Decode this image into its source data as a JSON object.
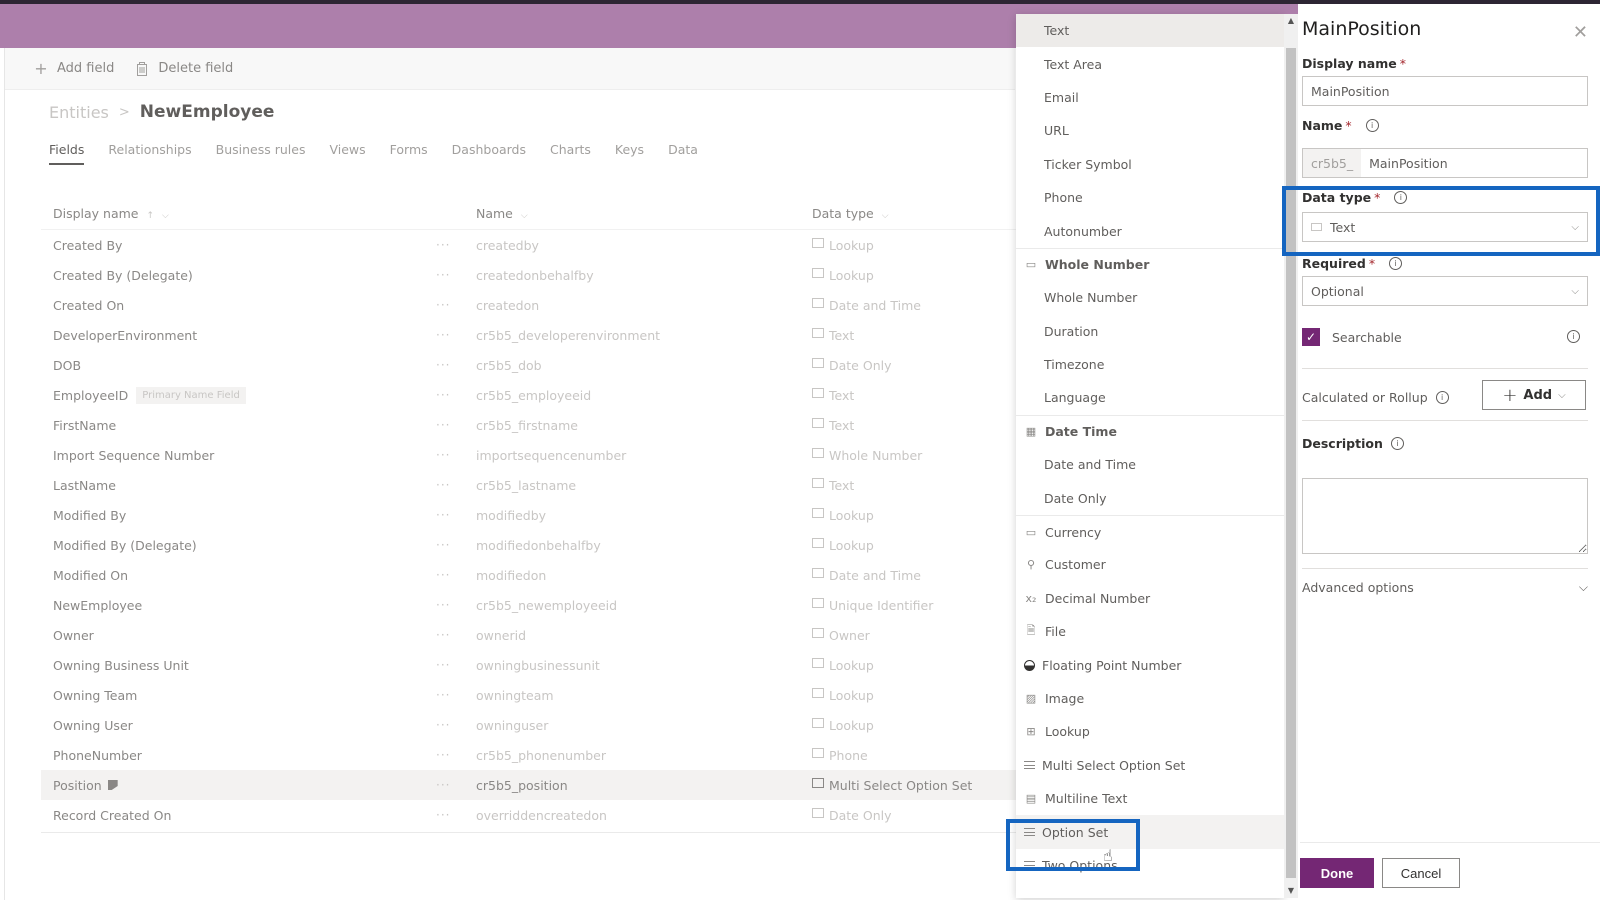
{
  "command_bar": {
    "add_field": "Add field",
    "delete_field": "Delete field"
  },
  "breadcrumb": {
    "root": "Entities",
    "separator": ">",
    "current": "NewEmployee"
  },
  "tabs": [
    {
      "label": "Fields",
      "active": true
    },
    {
      "label": "Relationships"
    },
    {
      "label": "Business rules"
    },
    {
      "label": "Views"
    },
    {
      "label": "Forms"
    },
    {
      "label": "Dashboards"
    },
    {
      "label": "Charts"
    },
    {
      "label": "Keys"
    },
    {
      "label": "Data"
    }
  ],
  "grid": {
    "columns": {
      "display_name": "Display name",
      "display_name_sort": "↑",
      "name": "Name",
      "data_type": "Data type"
    },
    "more": "···",
    "rows": [
      {
        "display": "Created By",
        "name": "createdby",
        "type": "Lookup"
      },
      {
        "display": "Created By (Delegate)",
        "name": "createdonbehalfby",
        "type": "Lookup"
      },
      {
        "display": "Created On",
        "name": "createdon",
        "type": "Date and Time"
      },
      {
        "display": "DeveloperEnvironment",
        "name": "cr5b5_developerenvironment",
        "type": "Text"
      },
      {
        "display": "DOB",
        "name": "cr5b5_dob",
        "type": "Date Only"
      },
      {
        "display": "EmployeeID",
        "name": "cr5b5_employeeid",
        "type": "Text",
        "tag": "Primary Name Field"
      },
      {
        "display": "FirstName",
        "name": "cr5b5_firstname",
        "type": "Text"
      },
      {
        "display": "Import Sequence Number",
        "name": "importsequencenumber",
        "type": "Whole Number"
      },
      {
        "display": "LastName",
        "name": "cr5b5_lastname",
        "type": "Text"
      },
      {
        "display": "Modified By",
        "name": "modifiedby",
        "type": "Lookup"
      },
      {
        "display": "Modified By (Delegate)",
        "name": "modifiedonbehalfby",
        "type": "Lookup"
      },
      {
        "display": "Modified On",
        "name": "modifiedon",
        "type": "Date and Time"
      },
      {
        "display": "NewEmployee",
        "name": "cr5b5_newemployeeid",
        "type": "Unique Identifier"
      },
      {
        "display": "Owner",
        "name": "ownerid",
        "type": "Owner"
      },
      {
        "display": "Owning Business Unit",
        "name": "owningbusinessunit",
        "type": "Lookup"
      },
      {
        "display": "Owning Team",
        "name": "owningteam",
        "type": "Lookup"
      },
      {
        "display": "Owning User",
        "name": "owninguser",
        "type": "Lookup"
      },
      {
        "display": "PhoneNumber",
        "name": "cr5b5_phonenumber",
        "type": "Phone"
      },
      {
        "display": "Position",
        "name": "cr5b5_position",
        "type": "Multi Select Option Set",
        "selected": true
      },
      {
        "display": "Record Created On",
        "name": "overriddencreatedon",
        "type": "Date Only"
      }
    ]
  },
  "dropdown": {
    "options": [
      {
        "label": "Text",
        "kind": "item",
        "highlighted": true
      },
      {
        "label": "Text Area",
        "kind": "item"
      },
      {
        "label": "Email",
        "kind": "item"
      },
      {
        "label": "URL",
        "kind": "item"
      },
      {
        "label": "Ticker Symbol",
        "kind": "item"
      },
      {
        "label": "Phone",
        "kind": "item"
      },
      {
        "label": "Autonumber",
        "kind": "item"
      },
      {
        "label": "Whole Number",
        "kind": "group",
        "icon": "whole-number-icon"
      },
      {
        "label": "Whole Number",
        "kind": "item"
      },
      {
        "label": "Duration",
        "kind": "item"
      },
      {
        "label": "Timezone",
        "kind": "item"
      },
      {
        "label": "Language",
        "kind": "item"
      },
      {
        "label": "Date Time",
        "kind": "group",
        "icon": "date-time-icon"
      },
      {
        "label": "Date and Time",
        "kind": "item"
      },
      {
        "label": "Date Only",
        "kind": "item"
      },
      {
        "label": "Currency",
        "kind": "group-item",
        "icon": "currency-icon"
      },
      {
        "label": "Customer",
        "kind": "icon-item",
        "icon": "customer-icon"
      },
      {
        "label": "Decimal Number",
        "kind": "icon-item",
        "icon": "decimal-icon"
      },
      {
        "label": "File",
        "kind": "icon-item",
        "icon": "file-icon"
      },
      {
        "label": "Floating Point Number",
        "kind": "icon-item",
        "icon": "floating-point-icon"
      },
      {
        "label": "Image",
        "kind": "icon-item",
        "icon": "image-icon"
      },
      {
        "label": "Lookup",
        "kind": "icon-item",
        "icon": "lookup-icon"
      },
      {
        "label": "Multi Select Option Set",
        "kind": "icon-item",
        "icon": "option-set-icon"
      },
      {
        "label": "Multiline Text",
        "kind": "icon-item",
        "icon": "multiline-text-icon"
      },
      {
        "label": "Option Set",
        "kind": "icon-item",
        "icon": "option-set-icon",
        "hovered": true
      },
      {
        "label": "Two Options",
        "kind": "icon-item",
        "icon": "option-set-icon"
      }
    ]
  },
  "panel": {
    "title": "MainPosition",
    "display_name_label": "Display name",
    "display_name_value": "MainPosition",
    "name_label": "Name",
    "name_prefix": "cr5b5_",
    "name_value": "MainPosition",
    "data_type_label": "Data type",
    "data_type_value": "Text",
    "required_label": "Required",
    "required_value": "Optional",
    "searchable_label": "Searchable",
    "searchable_checked": true,
    "calc_label": "Calculated or Rollup",
    "add_label": "Add",
    "description_label": "Description",
    "description_value": "",
    "advanced_label": "Advanced options",
    "done_label": "Done",
    "cancel_label": "Cancel",
    "required_marker": "*"
  },
  "colors": {
    "header": "#ad7fab",
    "accent": "#742774",
    "highlight_box": "#1565c0"
  }
}
